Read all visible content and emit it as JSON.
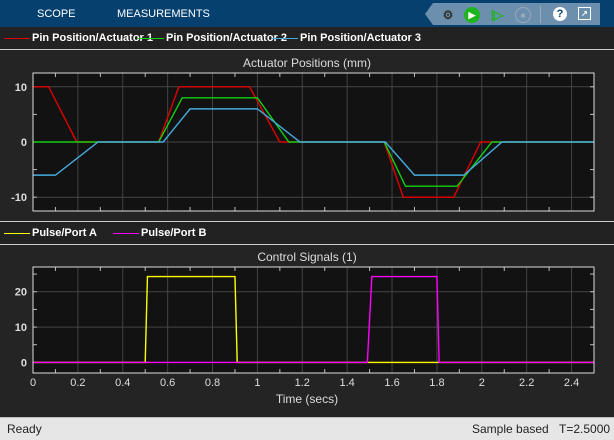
{
  "toolbar": {
    "tabs": [
      "SCOPE",
      "MEASUREMENTS"
    ],
    "icons": [
      "settings-icon",
      "run-icon",
      "step-forward-icon",
      "stop-icon",
      "help-icon",
      "undock-icon"
    ]
  },
  "legend1": [
    {
      "label": "Pin Position/Actuator 1",
      "color": "#e00000"
    },
    {
      "label": "Pin Position/Actuator 2",
      "color": "#11d011"
    },
    {
      "label": "Pin Position/Actuator 3",
      "color": "#44aadd"
    }
  ],
  "legend2": [
    {
      "label": "Pulse/Port A",
      "color": "#ffff00"
    },
    {
      "label": "Pulse/Port B",
      "color": "#ff00ff"
    }
  ],
  "status": {
    "left": "Ready",
    "mode": "Sample based",
    "time": "T=2.5000"
  },
  "chart_data": [
    {
      "type": "line",
      "title": "Actuator Positions (mm)",
      "xlim": [
        0,
        2.5
      ],
      "ylim": [
        -12.5,
        12.5
      ],
      "yticks": [
        -10,
        0,
        10
      ],
      "xticks": [
        0,
        0.2,
        0.4,
        0.6,
        0.8,
        1,
        1.2,
        1.4,
        1.6,
        1.8,
        2,
        2.2,
        2.4
      ],
      "show_xtick_labels": false,
      "grid": true,
      "series": [
        {
          "name": "Pin Position/Actuator 1",
          "points": [
            [
              0,
              10
            ],
            [
              0.07,
              10
            ],
            [
              0.195,
              0
            ],
            [
              0.56,
              0
            ],
            [
              0.65,
              10
            ],
            [
              0.965,
              10
            ],
            [
              1.1,
              0
            ],
            [
              1.565,
              0
            ],
            [
              1.65,
              -10
            ],
            [
              1.875,
              -10
            ],
            [
              1.995,
              0
            ],
            [
              2.5,
              0
            ]
          ]
        },
        {
          "name": "Pin Position/Actuator 2",
          "points": [
            [
              0,
              0
            ],
            [
              0.56,
              0
            ],
            [
              0.665,
              8
            ],
            [
              1.0,
              8
            ],
            [
              1.14,
              0
            ],
            [
              1.565,
              0
            ],
            [
              1.66,
              -8
            ],
            [
              1.89,
              -8
            ],
            [
              2.045,
              0
            ],
            [
              2.5,
              0
            ]
          ]
        },
        {
          "name": "Pin Position/Actuator 3",
          "points": [
            [
              0,
              -6
            ],
            [
              0.1,
              -6
            ],
            [
              0.29,
              0
            ],
            [
              0.58,
              0
            ],
            [
              0.7,
              6
            ],
            [
              1.0,
              6
            ],
            [
              1.19,
              0
            ],
            [
              1.57,
              0
            ],
            [
              1.7,
              -6
            ],
            [
              1.92,
              -6
            ],
            [
              2.09,
              0
            ],
            [
              2.5,
              0
            ]
          ]
        }
      ]
    },
    {
      "type": "line",
      "title": "Control Signals (1)",
      "xlabel": "Time (secs)",
      "xlim": [
        0,
        2.5
      ],
      "ylim": [
        -3,
        27
      ],
      "yticks": [
        0,
        10,
        20
      ],
      "xticks": [
        0,
        0.2,
        0.4,
        0.6,
        0.8,
        1,
        1.2,
        1.4,
        1.6,
        1.8,
        2,
        2.2,
        2.4
      ],
      "xticklabels": [
        "0",
        "0.2",
        "0.4",
        "0.6",
        "0.8",
        "1",
        "1.2",
        "1.4",
        "1.6",
        "1.8",
        "2",
        "2.2",
        "2.4"
      ],
      "show_xtick_labels": true,
      "grid": true,
      "series": [
        {
          "name": "Pulse/Port A",
          "points": [
            [
              0,
              0
            ],
            [
              0.5,
              0
            ],
            [
              0.51,
              24.3
            ],
            [
              0.9,
              24.3
            ],
            [
              0.91,
              0
            ],
            [
              2.5,
              0
            ]
          ]
        },
        {
          "name": "Pulse/Port B",
          "points": [
            [
              0,
              0
            ],
            [
              1.49,
              0
            ],
            [
              1.51,
              24.3
            ],
            [
              1.8,
              24.3
            ],
            [
              1.81,
              0
            ],
            [
              2.5,
              0
            ]
          ]
        }
      ]
    }
  ]
}
